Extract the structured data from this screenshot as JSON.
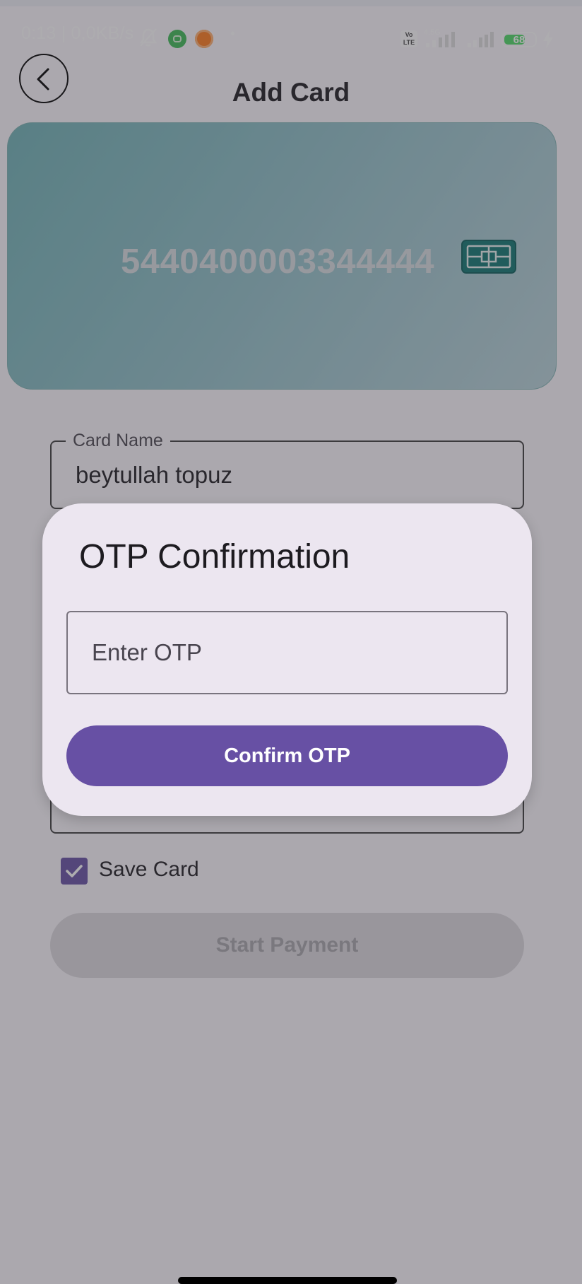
{
  "status_bar": {
    "text": "0:13 | 0,0KB/s",
    "volte": "Vo LTE",
    "network": "4.5G",
    "battery": "68",
    "icons": [
      "bell-off-icon",
      "app-icon-green",
      "app-icon-orange",
      "signal-icon",
      "signal-icon",
      "battery-icon",
      "charging-bolt-icon"
    ]
  },
  "header": {
    "title": "Add Card",
    "back_icon": "chevron-left-icon"
  },
  "card": {
    "number": "5440400003344444",
    "chip_icon": "chip-icon"
  },
  "form": {
    "card_name": {
      "label": "Card Name",
      "value": "beytullah topuz"
    },
    "save_card": {
      "label": "Save Card",
      "checked": true
    },
    "start_payment_label": "Start Payment"
  },
  "dialog": {
    "title": "OTP Confirmation",
    "otp_placeholder": "Enter OTP",
    "confirm_label": "Confirm OTP"
  },
  "colors": {
    "primary": "#6750a4",
    "dialog_bg": "#ece6f0",
    "card_teal": "#6fb3b6"
  }
}
